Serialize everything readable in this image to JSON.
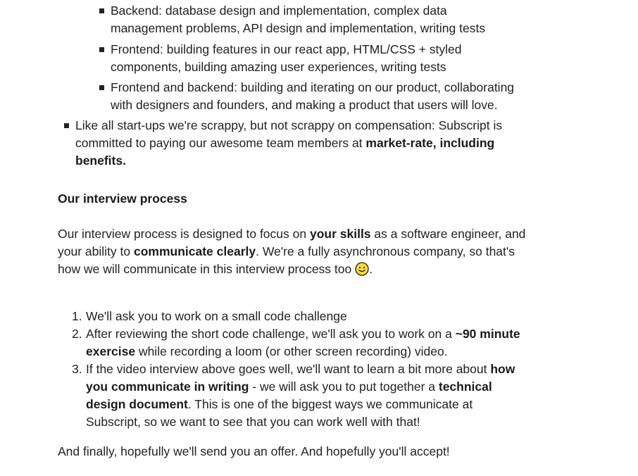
{
  "nested_list": [
    {
      "line1": "Backend: database design and implementation, complex data",
      "line2": "management problems, API design and implementation, writing tests"
    },
    {
      "line1": "Frontend: building features in our react app, HTML/CSS + styled",
      "line2": "components, building amazing user experiences, writing tests"
    },
    {
      "line1": "Frontend and backend: building and iterating on our product, collaborating",
      "line2": "with designers and founders, and making a product that users will love."
    }
  ],
  "compensation_item": {
    "line1": "Like all start-ups we're scrappy, but not scrappy on compensation: Subscript is",
    "line2_normal": "committed to paying our awesome team members at ",
    "line2_bold": "market-rate, including",
    "line3_bold": "benefits."
  },
  "interview_heading": "Our interview process",
  "intro": {
    "p1": "Our interview process is designed to focus on ",
    "b1": "your skills",
    "p2": " as a software engineer, and",
    "p3": "your ability to ",
    "b2": "communicate clearly",
    "p4": ". We're a fully asynchronous company, so that's",
    "p5": "how we will communicate in this interview process too ",
    "p6": "."
  },
  "steps": [
    {
      "num": "1.",
      "text": "We'll ask you to work on a small code challenge"
    },
    {
      "num": "2.",
      "l1": "After reviewing the short code challenge, we'll ask you to work on a ",
      "l1_bold": "~90 minute",
      "l2_bold": "exercise",
      "l2": " while recording a loom (or other screen recording) video."
    },
    {
      "num": "3.",
      "l1": "If the video interview above goes well, we'll want to learn a bit more about ",
      "l1_bold": "how",
      "l2_bold": "you communicate in writing",
      "l2": " - we will ask you to put together a ",
      "l2_bold2": "technical",
      "l3_bold": "design document",
      "l3": ". This is one of the biggest ways we communicate at",
      "l4": "Subscript, so we want to see that you can work well with that!"
    }
  ],
  "closing": "And finally, hopefully we'll send you an offer. And hopefully you'll accept!"
}
